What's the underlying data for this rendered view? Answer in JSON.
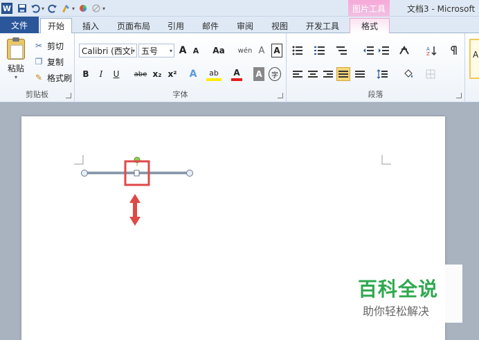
{
  "title_bar": {
    "app_icon_letter": "W",
    "contextual_group": "图片工具",
    "title": "文档3 - Microsoft"
  },
  "tabs": [
    {
      "label": "文件"
    },
    {
      "label": "开始"
    },
    {
      "label": "插入"
    },
    {
      "label": "页面布局"
    },
    {
      "label": "引用"
    },
    {
      "label": "邮件"
    },
    {
      "label": "审阅"
    },
    {
      "label": "视图"
    },
    {
      "label": "开发工具"
    },
    {
      "label": "格式"
    }
  ],
  "ribbon": {
    "clipboard": {
      "label": "剪贴板",
      "paste": "粘贴",
      "cut": "剪切",
      "copy": "复制",
      "format_painter": "格式刷"
    },
    "font": {
      "label": "字体",
      "font_name": "Calibri (西文i",
      "font_size": "五号",
      "grow": "A",
      "shrink": "A",
      "change_case": "Aa",
      "bold": "B",
      "italic": "I",
      "underline": "U",
      "strike": "abe",
      "subscript": "x₂",
      "superscript": "x²",
      "text_effect": "A",
      "highlight": "ab",
      "font_color": "A",
      "char_shading": "A",
      "enclose": "字",
      "phonetic": "wén",
      "clear_format": "A"
    },
    "paragraph": {
      "label": "段落"
    },
    "styles_preview": "A"
  },
  "watermark": {
    "title": "百科全说",
    "subtitle": "助你轻松解决"
  },
  "colors": {
    "file_tab": "#2b579a",
    "selection_box": "#e04848",
    "watermark_green": "#2fa84f"
  }
}
